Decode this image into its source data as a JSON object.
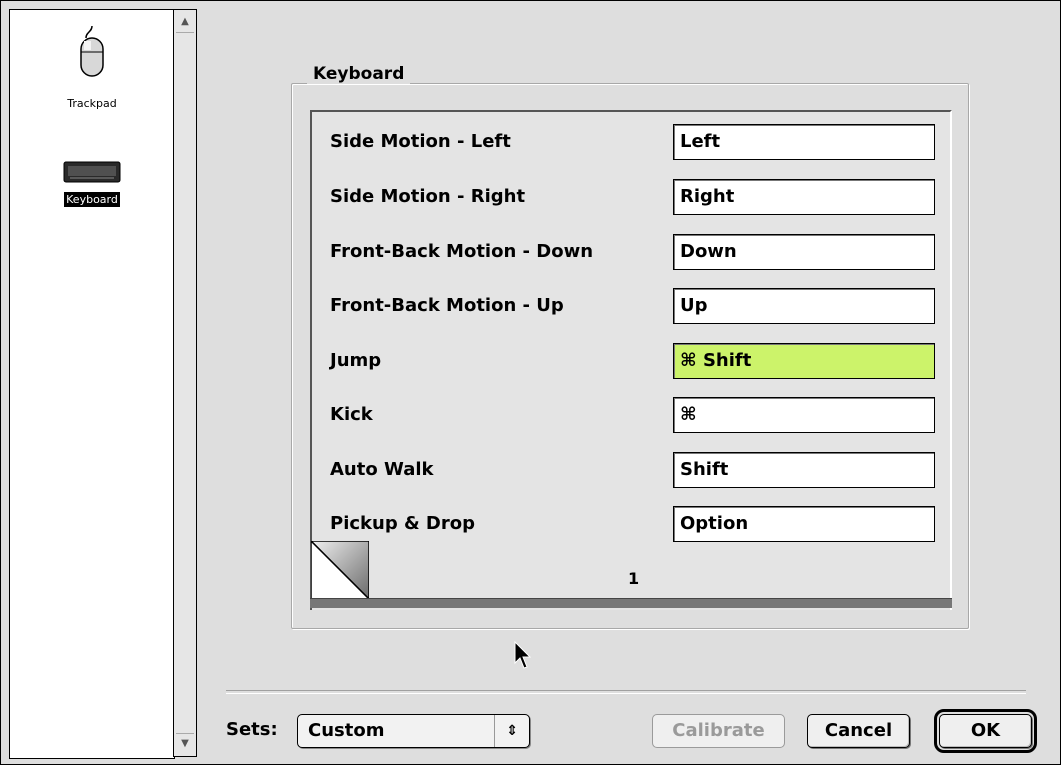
{
  "sidebar": {
    "items": [
      {
        "label": "Trackpad",
        "icon": "mouse-icon"
      },
      {
        "label": "Keyboard",
        "icon": "keyboard-icon",
        "selected": true
      }
    ]
  },
  "group": {
    "title": "Keyboard",
    "page_number": "1",
    "rows": [
      {
        "label": "Side Motion - Left",
        "value": "Left"
      },
      {
        "label": "Side Motion - Right",
        "value": "Right"
      },
      {
        "label": "Front-Back Motion - Down",
        "value": "Down"
      },
      {
        "label": "Front-Back Motion - Up",
        "value": "Up"
      },
      {
        "label": "Jump",
        "value": "⌘ Shift",
        "active": true
      },
      {
        "label": "Kick",
        "value": "⌘"
      },
      {
        "label": "Auto Walk",
        "value": "Shift"
      },
      {
        "label": "Pickup & Drop",
        "value": "Option"
      }
    ]
  },
  "footer": {
    "sets_label": "Sets:",
    "sets_value": "Custom",
    "sets_arrows": "⇕",
    "calibrate_label": "Calibrate",
    "cancel_label": "Cancel",
    "ok_label": "OK"
  },
  "colors": {
    "active_field": "#ccf36a"
  }
}
